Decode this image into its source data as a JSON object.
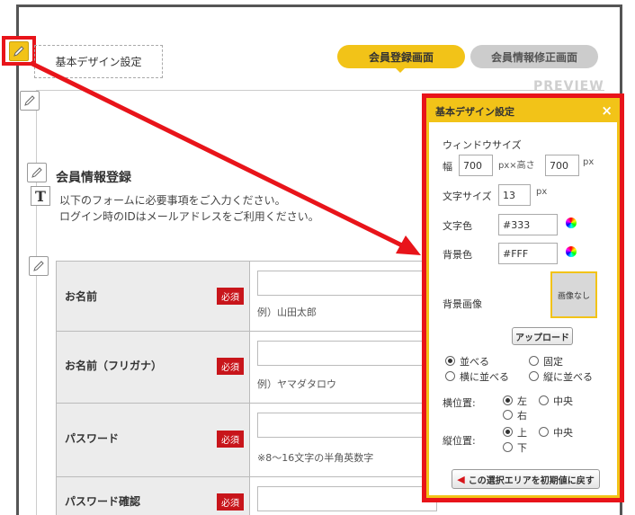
{
  "header": {
    "design_settings_label": "基本デザイン設定",
    "tabs": [
      {
        "label": "会員登録画面",
        "active": true
      },
      {
        "label": "会員情報修正画面",
        "active": false
      }
    ],
    "preview_label": "PREVIEW"
  },
  "form": {
    "section_title": "会員情報登録",
    "intro_line1": "以下のフォームに必要事項をご入力ください。",
    "intro_line2": "ログイン時のIDはメールアドレスをご利用ください。",
    "required_badge": "必須",
    "rows": [
      {
        "label": "お名前",
        "hint": "例）山田太郎"
      },
      {
        "label": "お名前（フリガナ）",
        "hint": "例）ヤマダタロウ"
      },
      {
        "label": "パスワード",
        "hint": "※8～16文字の半角英数字"
      },
      {
        "label": "パスワード確認",
        "hint": ""
      }
    ]
  },
  "panel": {
    "title": "基本デザイン設定",
    "close_icon": "×",
    "window_size_label": "ウィンドウサイズ",
    "width_label": "幅",
    "width_value": "700",
    "px_height_label": "px×高さ",
    "height_value": "700",
    "px_unit": "px",
    "font_size_label": "文字サイズ",
    "font_size_value": "13",
    "text_color_label": "文字色",
    "text_color_value": "#333",
    "bg_color_label": "背景色",
    "bg_color_value": "#FFF",
    "bg_image_label": "背景画像",
    "no_image_label": "画像なし",
    "upload_button": "アップロード",
    "layout_options": [
      "並べる",
      "固定",
      "横に並べる",
      "縦に並べる"
    ],
    "h_pos_label": "横位置:",
    "h_pos_options": [
      "左",
      "中央",
      "右"
    ],
    "v_pos_label": "縦位置:",
    "v_pos_options": [
      "上",
      "中央",
      "下"
    ],
    "reset_button": "この選択エリアを初期値に戻す"
  },
  "colors": {
    "accent": "#f2c318",
    "highlight": "#e8141a",
    "required": "#c8151b"
  }
}
